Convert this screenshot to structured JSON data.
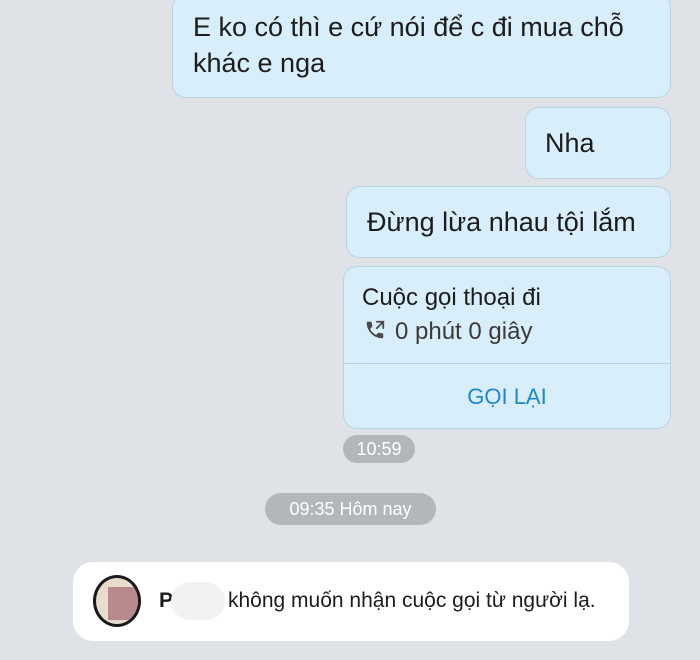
{
  "messages": [
    {
      "text": "E ko có thì e cứ nói để c đi mua chỗ khác e nga"
    },
    {
      "text": "Nha"
    },
    {
      "text": "Đừng lừa nhau tội lắm"
    }
  ],
  "call_card": {
    "title": "Cuộc gọi thoại đi",
    "icon": "outgoing-phone-icon",
    "duration": "0 phút 0 giây",
    "callback_label": "GỌI LẠI"
  },
  "timestamps": {
    "call_time": "10:59",
    "day_separator": "09:35 Hôm nay"
  },
  "notice": {
    "name": "P",
    "text": "không muốn nhận cuộc gọi từ người lạ."
  },
  "colors": {
    "background": "#dfe3e8",
    "bubble": "#d9eefb",
    "accent": "#1e88c9",
    "time_pill": "#b3b7bc"
  }
}
